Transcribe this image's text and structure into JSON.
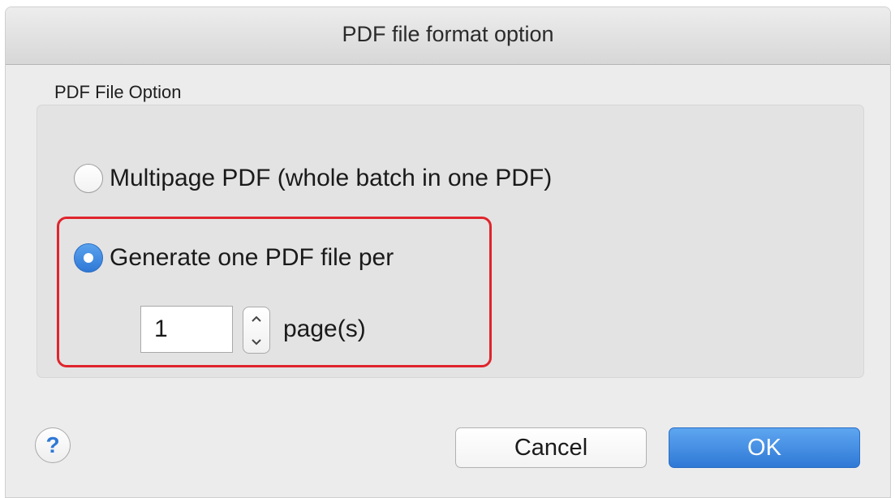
{
  "dialog": {
    "title": "PDF file format option"
  },
  "pdf_option": {
    "group_label": "PDF File Option",
    "options": [
      {
        "label": "Multipage PDF (whole batch in one PDF)",
        "selected": false
      },
      {
        "label": "Generate one PDF file per",
        "selected": true
      }
    ],
    "pages_value": "1",
    "pages_unit": "page(s)"
  },
  "footer": {
    "help_label": "?",
    "cancel_label": "Cancel",
    "ok_label": "OK"
  },
  "colors": {
    "accent": "#2f79d6",
    "highlight": "#e0242c",
    "background": "#ececec",
    "group_background": "#e3e3e3"
  },
  "icons": {
    "help": "question-mark-icon",
    "stepper_up": "chevron-up-icon",
    "stepper_down": "chevron-down-icon"
  }
}
